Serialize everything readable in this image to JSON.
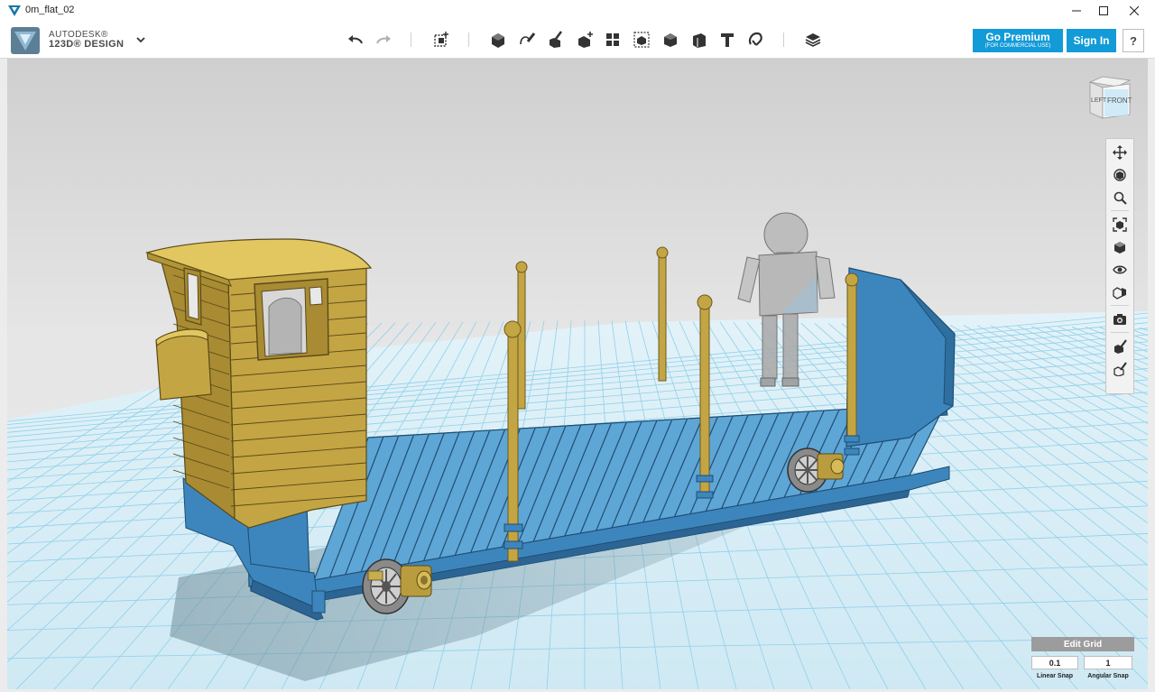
{
  "window": {
    "title": "0m_flat_02",
    "controls": [
      "minimize-icon",
      "maximize-icon",
      "close-icon"
    ]
  },
  "app": {
    "brand_line1": "AUTODESK®",
    "brand_line2": "123D® DESIGN",
    "menu_icon": "chevron-down-icon"
  },
  "toolbar": {
    "tools": [
      "undo-icon",
      "redo-icon",
      "transform-icon",
      "primitives-icon",
      "sketch-icon",
      "construct-icon",
      "modify-icon",
      "pattern-icon",
      "group-icon",
      "combine-icon",
      "measure-icon",
      "text-icon",
      "snap-icon",
      "material-icon"
    ]
  },
  "account": {
    "premium_label": "Go Premium",
    "premium_sub": "(FOR COMMERCIAL USE)",
    "signin_label": "Sign In",
    "help_label": "?"
  },
  "viewcube": {
    "left_label": "LEFT",
    "front_label": "FRONT"
  },
  "nav_tools": [
    "pan-icon",
    "orbit-icon",
    "zoom-icon",
    "fit-icon",
    "view-icon",
    "visibility-icon",
    "material-view-icon",
    "camera-icon",
    "hide-icon",
    "show-icon"
  ],
  "grid": {
    "edit_label": "Edit Grid",
    "linear_snap_value": "0.1",
    "angular_snap_value": "1",
    "linear_label": "Linear Snap",
    "angular_label": "Angular Snap"
  },
  "colors": {
    "accent": "#139bd8",
    "model_blue": "#3d86bd",
    "model_gold": "#c4a544",
    "grid_line": "#8fd0ea",
    "grid_floor": "#d9eef7"
  }
}
